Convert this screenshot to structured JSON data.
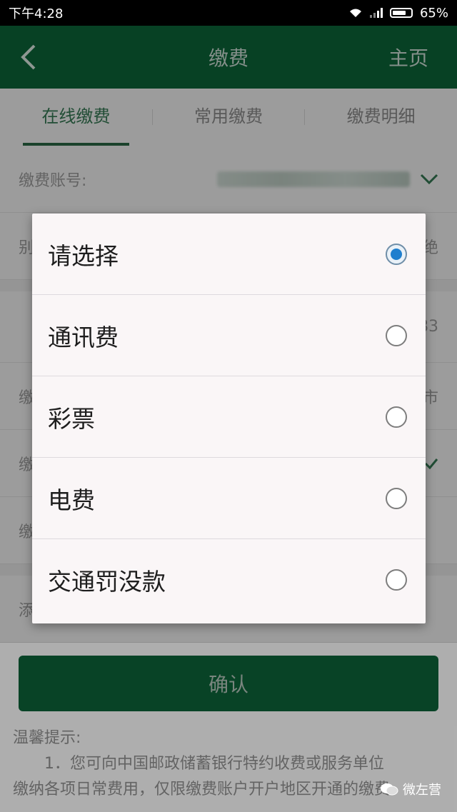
{
  "status_bar": {
    "time": "下午4:28",
    "battery": "65%"
  },
  "header": {
    "title": "缴费",
    "home": "主页"
  },
  "tabs": [
    {
      "label": "在线缴费",
      "active": true
    },
    {
      "label": "常用缴费",
      "active": false
    },
    {
      "label": "缴费明细",
      "active": false
    }
  ],
  "form": {
    "account_label": "缴费账号:",
    "row2_label": "别",
    "row2_value": "绝",
    "row3_value": "83",
    "row4_label": "缴",
    "row4_value": "市",
    "row5_label": "缴",
    "row6_label": "缴",
    "row7_label": "添"
  },
  "dialog": {
    "options": [
      {
        "label": "请选择",
        "selected": true
      },
      {
        "label": "通讯费",
        "selected": false
      },
      {
        "label": "彩票",
        "selected": false
      },
      {
        "label": "电费",
        "selected": false
      },
      {
        "label": "交通罚没款",
        "selected": false
      }
    ]
  },
  "confirm_label": "确认",
  "tips": {
    "title": "温馨提示:",
    "line1": "1．您可向中国邮政储蓄银行特约收费或服务单位",
    "line2": "缴纳各项日常费用，仅限缴费账户开户地区开通的缴费"
  },
  "watermark": "微左营",
  "colors": {
    "primary": "#0a5a33",
    "radio_selected": "#1f7fce"
  }
}
